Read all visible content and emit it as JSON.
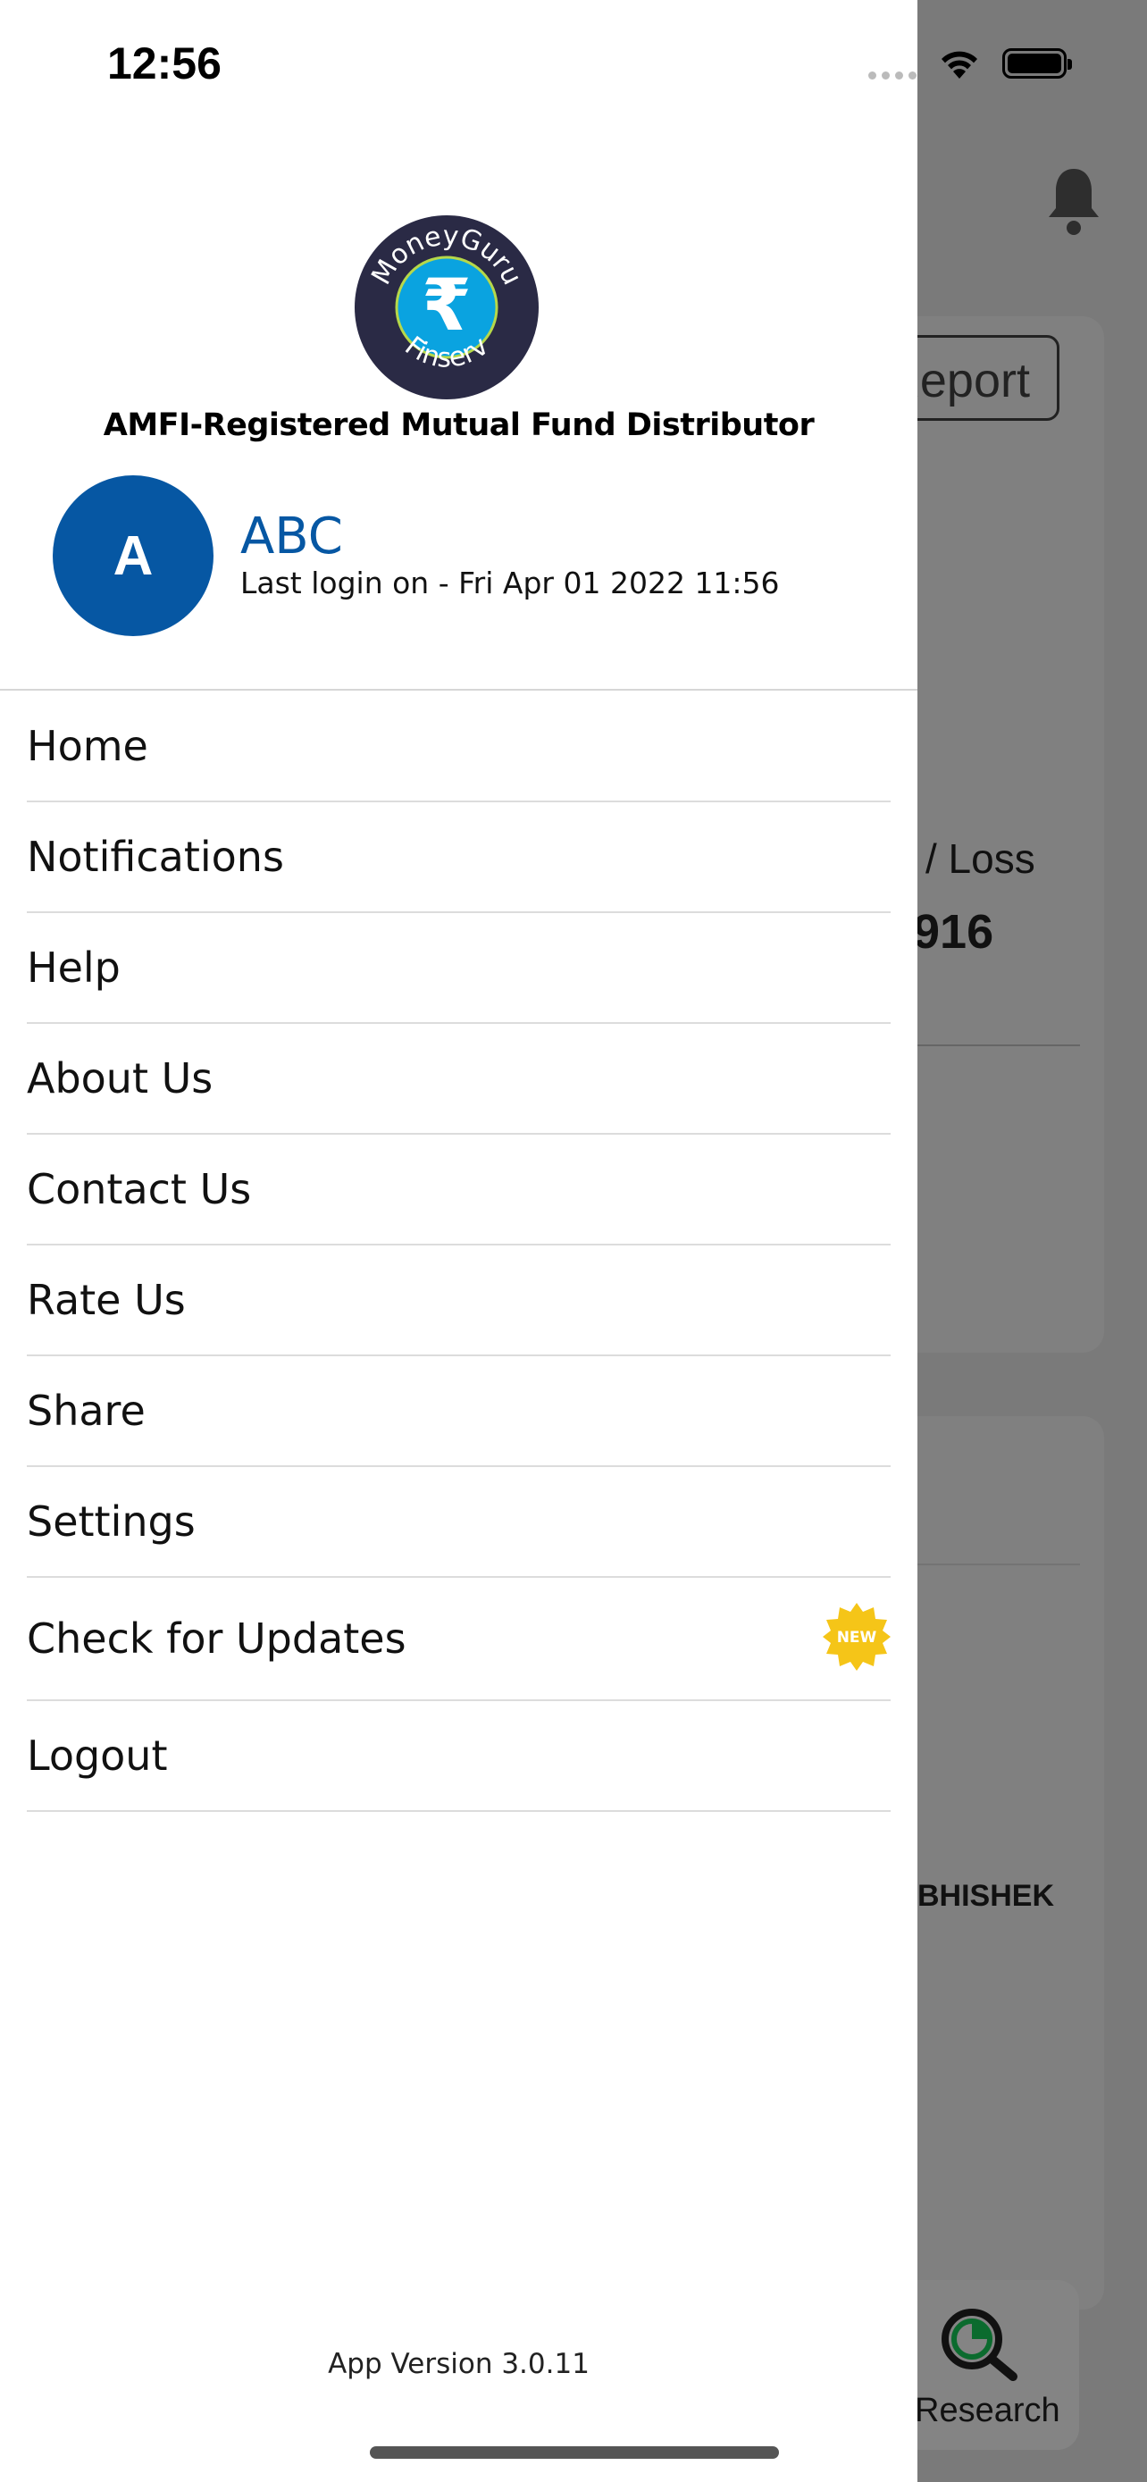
{
  "status_bar": {
    "time": "12:56",
    "icons": [
      "cellular-dots-icon",
      "wifi-icon",
      "battery-icon"
    ]
  },
  "background": {
    "report_button": "Report",
    "profit_loss_label": "/ Loss",
    "profit_loss_value": "916",
    "name_fragment": "BHISHEK",
    "research_tab": "Research",
    "icons": [
      "bell-icon",
      "research-magnifier-icon"
    ]
  },
  "drawer": {
    "logo": {
      "top_text": "MoneyGuru",
      "bottom_text": "Finserv",
      "colors": {
        "ring": "#2a2a45",
        "center": "#0aa3e0"
      }
    },
    "tagline": "AMFI-Registered Mutual Fund Distributor",
    "user": {
      "avatar_letter": "A",
      "name": "ABC",
      "last_login": "Last login on - Fri Apr 01 2022 11:56",
      "accent": "#0657a3"
    },
    "menu": [
      {
        "label": "Home"
      },
      {
        "label": "Notifications"
      },
      {
        "label": "Help"
      },
      {
        "label": "About Us"
      },
      {
        "label": "Contact Us"
      },
      {
        "label": "Rate Us"
      },
      {
        "label": "Share"
      },
      {
        "label": "Settings"
      },
      {
        "label": "Check for Updates",
        "badge": "NEW",
        "badge_color": "#f5c518"
      },
      {
        "label": "Logout"
      }
    ],
    "app_version": "App Version 3.0.11"
  }
}
